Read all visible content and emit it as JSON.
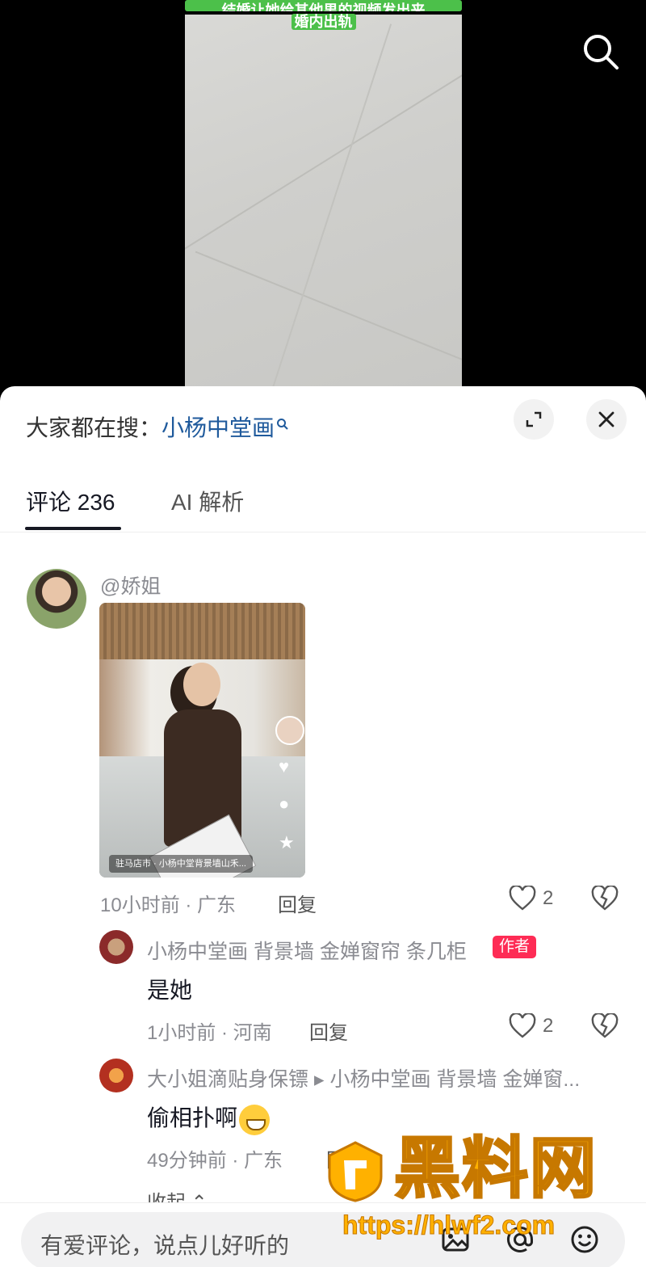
{
  "video": {
    "caption_line1": "结婚让她给其他男的视频发出来",
    "caption_line2": "婚内出轨"
  },
  "top_search_icon": "search-icon",
  "sheet": {
    "hot_search_prefix": "大家都在搜：",
    "hot_search_keyword": "小杨中堂画",
    "expand_icon": "expand-icon",
    "close_icon": "close-icon"
  },
  "tabs": [
    {
      "label": "评论 236"
    },
    {
      "label": "AI 解析"
    }
  ],
  "comments": {
    "main": {
      "username": "@娇姐",
      "media": {
        "location_tag": "驻马店市 · 小杨中堂背景墙山禾..."
      },
      "meta": "10小时前 · 广东",
      "reply_label": "回复",
      "like_count": "2"
    },
    "replies": [
      {
        "username": "小杨中堂画 背景墙 金婵窗帘 条几柜",
        "badge": "作者",
        "text": "是她",
        "meta": "1小时前 · 河南",
        "reply_label": "回复",
        "like_count": "2"
      },
      {
        "username": "大小姐滴贴身保镖 ▸ 小杨中堂画 背景墙 金婵窗...",
        "text": "偷相扑啊",
        "meta": "49分钟前 · 广东",
        "reply_label": "回复"
      }
    ],
    "collapse_label": "收起"
  },
  "input": {
    "placeholder": "有爱评论，说点儿好听的",
    "icons": [
      "image-icon",
      "at-icon",
      "emoji-icon"
    ]
  },
  "watermark": {
    "logo_text": "黑料网",
    "url": "https://hlwf2.com"
  },
  "colors": {
    "accent": "#fe2c55",
    "link": "#1f5a9c",
    "caption_bg": "#4cc04a",
    "watermark": "#ffb100"
  }
}
